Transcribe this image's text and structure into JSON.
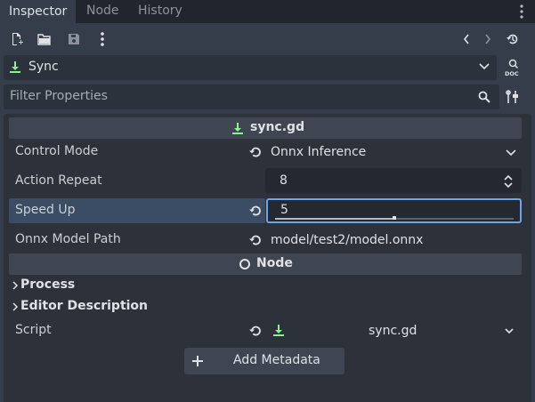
{
  "tabs": [
    {
      "label": "Inspector",
      "active": true
    },
    {
      "label": "Node",
      "active": false
    },
    {
      "label": "History",
      "active": false
    }
  ],
  "object_selector": {
    "label": "Sync"
  },
  "filter": {
    "placeholder": "Filter Properties"
  },
  "script_section": {
    "title": "sync.gd"
  },
  "properties": {
    "control_mode": {
      "label": "Control Mode",
      "value": "Onnx Inference"
    },
    "action_repeat": {
      "label": "Action Repeat",
      "value": "8"
    },
    "speed_up": {
      "label": "Speed Up",
      "value": "5",
      "slider_fraction": 0.5
    },
    "onnx_model_path": {
      "label": "Onnx Model Path",
      "value": "model/test2/model.onnx"
    }
  },
  "node_section": {
    "title": "Node"
  },
  "groups": {
    "process": {
      "label": "Process"
    },
    "editor_description": {
      "label": "Editor Description"
    }
  },
  "script_row": {
    "label": "Script",
    "value": "sync.gd"
  },
  "add_metadata": {
    "label": "Add Metadata"
  },
  "colors": {
    "accent": "#6aa6e8",
    "script_icon": "#8eef97",
    "highlight_row": "#3b4d64",
    "panel_bg": "#2c313a",
    "window_bg": "#363d4a"
  },
  "icons": [
    "new-script-icon",
    "open-folder-icon",
    "save-icon",
    "kebab-menu-icon",
    "history-back-icon",
    "history-forward-icon",
    "object-history-icon",
    "script-icon",
    "chevron-down-icon",
    "doc-icon",
    "search-icon",
    "filter-tools-icon",
    "revert-icon",
    "updown-arrows-icon",
    "node-circle-icon",
    "chevron-right-icon",
    "plus-icon"
  ]
}
